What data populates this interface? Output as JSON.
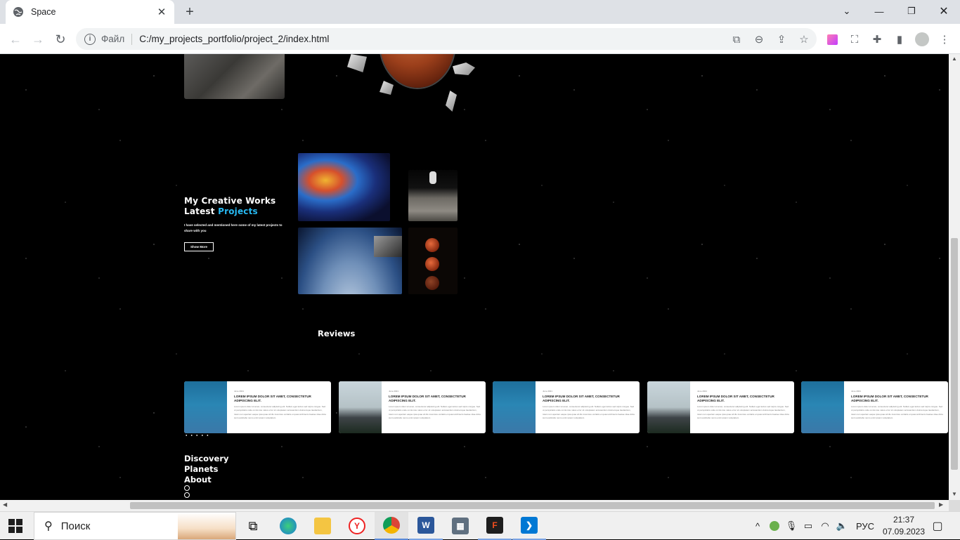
{
  "browser": {
    "tab_title": "Space",
    "address_scheme_label": "Файл",
    "address_url": "C:/my_projects_portfolio/project_2/index.html"
  },
  "page": {
    "works": {
      "title_line1": "My Creative Works",
      "title_line2_prefix": "Latest ",
      "title_line2_accent": "Projects",
      "description": "I have selected and mentioned here some of my latest projects to share with you",
      "button_label": "Show More"
    },
    "reviews": {
      "title": "Reviews",
      "cards": [
        {
          "date": "June 2021",
          "heading": "LOREM IPSUM DOLOR SIT AMET, CONSECTETUR ADIPISCING ELIT.",
          "text": "Lorem ipsum dolor sit amet, consectetur adipiscing elit. Nullam eget lectus sed turpis congue. Sed ut perspiciatis unde omnis iste natus error sit voluptatem accusantium doloremque laudantium, totam rem aperiam eaque ipsa quae ab illo inventore veritatis et quasi architecto beatae vitae dicta sunt explicabo nemo enim ipsam voluptatem.",
          "photo": "woman-blue-hood"
        },
        {
          "date": "June 2021",
          "heading": "LOREM IPSUM DOLOR SIT AMET, CONSECTETUR ADIPISCING ELIT.",
          "text": "Lorem ipsum dolor sit amet, consectetur adipiscing elit. Nullam eget lectus sed turpis congue. Sed ut perspiciatis unde omnis iste natus error sit voluptatem accusantium doloremque laudantium, totam rem aperiam eaque ipsa quae ab illo inventore veritatis et quasi architecto beatae vitae dicta sunt explicabo nemo enim ipsam voluptatem.",
          "photo": "man-red-beanie"
        },
        {
          "date": "June 2021",
          "heading": "LOREM IPSUM DOLOR SIT AMET, CONSECTETUR ADIPISCING ELIT.",
          "text": "Lorem ipsum dolor sit amet, consectetur adipiscing elit. Nullam eget lectus sed turpis congue. Sed ut perspiciatis unde omnis iste natus error sit voluptatem accusantium doloremque laudantium, totam rem aperiam eaque ipsa quae ab illo inventore veritatis et quasi architecto beatae vitae dicta sunt explicabo nemo enim ipsam voluptatem.",
          "photo": "woman-blue-hood"
        },
        {
          "date": "June 2021",
          "heading": "LOREM IPSUM DOLOR SIT AMET, CONSECTETUR ADIPISCING ELIT.",
          "text": "Lorem ipsum dolor sit amet, consectetur adipiscing elit. Nullam eget lectus sed turpis congue. Sed ut perspiciatis unde omnis iste natus error sit voluptatem accusantium doloremque laudantium, totam rem aperiam eaque ipsa quae ab illo inventore veritatis et quasi architecto beatae vitae dicta sunt explicabo nemo enim ipsam voluptatem.",
          "photo": "man-red-beanie"
        },
        {
          "date": "June 2021",
          "heading": "LOREM IPSUM DOLOR SIT AMET, CONSECTETUR ADIPISCING ELIT.",
          "text": "Lorem ipsum dolor sit amet, consectetur adipiscing elit. Nullam eget lectus sed turpis congue. Sed ut perspiciatis unde omnis iste natus error sit voluptatem accusantium doloremque laudantium, totam rem aperiam eaque ipsa quae ab illo inventore veritatis et quasi architecto beatae vitae dicta sunt explicabo nemo enim ipsam voluptatem.",
          "photo": "woman-blue-hood"
        }
      ],
      "pager_dots": "● ● ● ● ●"
    },
    "footer": {
      "links": [
        "Discovery",
        "Planets",
        "About"
      ]
    },
    "accent_color": "#27b9f2"
  },
  "taskbar": {
    "search_placeholder": "Поиск",
    "language": "РУС",
    "time": "21:37",
    "date": "07.09.2023"
  }
}
